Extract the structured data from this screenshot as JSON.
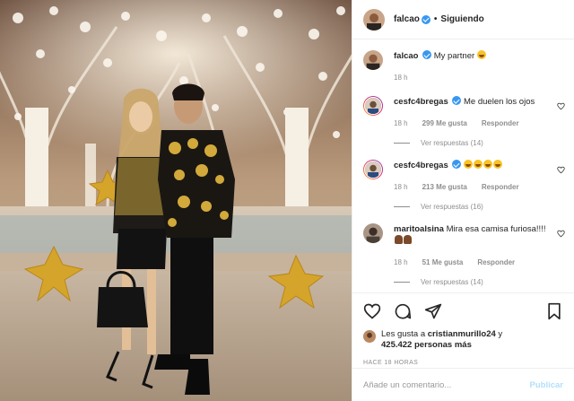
{
  "header": {
    "username": "falcao",
    "separator": "•",
    "follow_label": "Siguiendo"
  },
  "caption": {
    "username": "falcao",
    "text": "My partner",
    "time": "18 h"
  },
  "comments": [
    {
      "username": "cesfc4bregas",
      "text": "Me duelen los ojos",
      "time": "18 h",
      "likes": "299 Me gusta",
      "reply_label": "Responder",
      "view_replies": "Ver respuestas (14)"
    },
    {
      "username": "cesfc4bregas",
      "text": "",
      "emoji_count": 4,
      "time": "18 h",
      "likes": "213 Me gusta",
      "reply_label": "Responder",
      "view_replies": "Ver respuestas (16)"
    },
    {
      "username": "maritoalsina",
      "text": "Mira esa camisa furiosa!!!!",
      "time": "18 h",
      "likes": "51 Me gusta",
      "reply_label": "Responder",
      "view_replies": "Ver respuestas (14)"
    }
  ],
  "likes_summary": {
    "prefix": "Les gusta a ",
    "user": "cristianmurillo24",
    "middle": " y",
    "count": "425.422 personas más"
  },
  "timestamp": "HACE 18 HORAS",
  "comment_box": {
    "placeholder": "Añade un comentario...",
    "publish_label": "Publicar"
  },
  "colors": {
    "verified": "#3897f0",
    "publish": "#b2dffc",
    "meta": "#8e8e8e"
  }
}
